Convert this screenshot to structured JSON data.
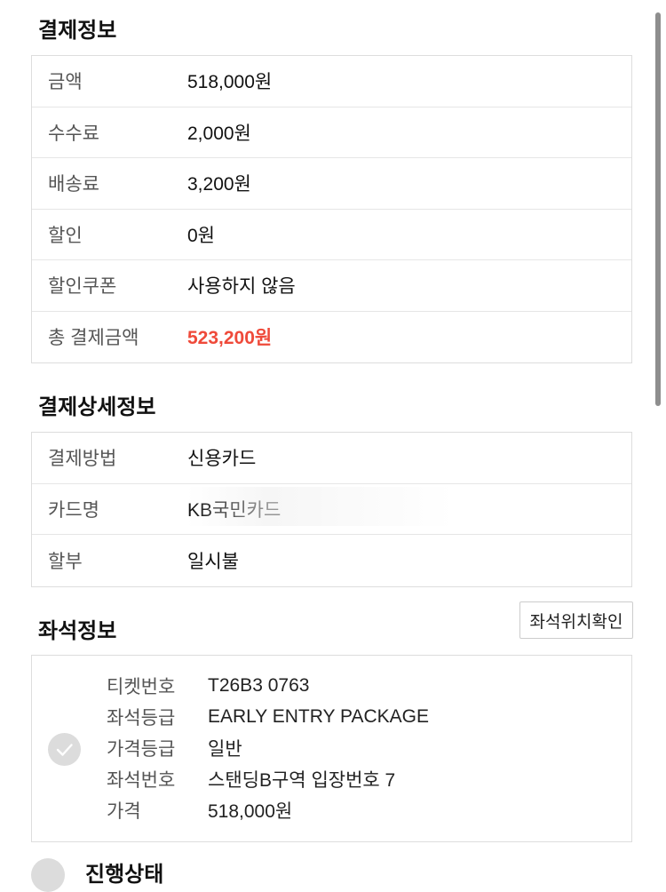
{
  "payment_info": {
    "title": "결제정보",
    "rows": [
      {
        "label": "금액",
        "value": "518,000원"
      },
      {
        "label": "수수료",
        "value": "2,000원"
      },
      {
        "label": "배송료",
        "value": "3,200원"
      },
      {
        "label": "할인",
        "value": "0원"
      },
      {
        "label": "할인쿠폰",
        "value": "사용하지 않음"
      },
      {
        "label": "총 결제금액",
        "value": "523,200원"
      }
    ],
    "total_color": "#ef4a3a"
  },
  "payment_detail": {
    "title": "결제상세정보",
    "rows": [
      {
        "label": "결제방법",
        "value": "신용카드"
      },
      {
        "label": "카드명",
        "value": "KB국민카드"
      },
      {
        "label": "할부",
        "value": "일시불"
      }
    ]
  },
  "seat_info": {
    "title": "좌석정보",
    "location_button": "좌석위치확인",
    "check_icon": "check-circle-icon",
    "rows": [
      {
        "label": "티켓번호",
        "value": "T26B3 0763"
      },
      {
        "label": "좌석등급",
        "value": "EARLY ENTRY PACKAGE"
      },
      {
        "label": "가격등급",
        "value": "일반"
      },
      {
        "label": "좌석번호",
        "value": "스탠딩B구역 입장번호 7"
      },
      {
        "label": "가격",
        "value": "518,000원"
      }
    ]
  },
  "next_section": {
    "title": "진행상태"
  }
}
